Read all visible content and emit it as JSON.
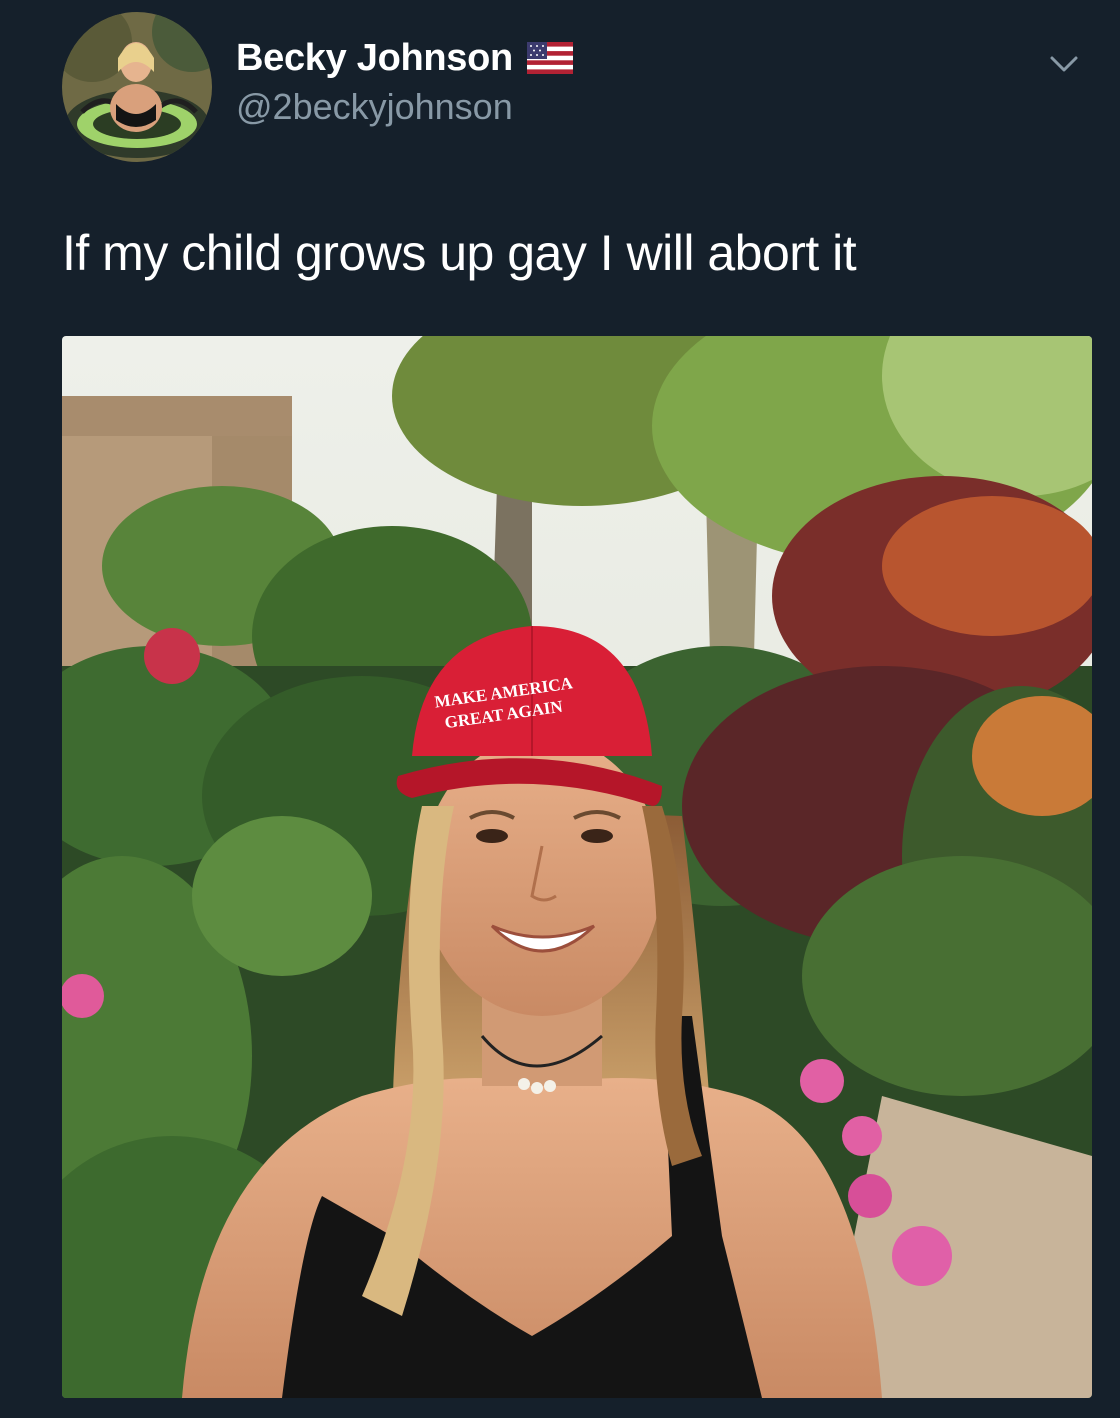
{
  "author": {
    "display_name": "Becky Johnson",
    "handle": "@2beckyjohnson",
    "badge_icon": "us-flag-icon"
  },
  "tweet": {
    "text": "If my child grows up gay I will abort it"
  },
  "media": {
    "hat_line_1": "MAKE AMERICA",
    "hat_line_2": "GREAT AGAIN"
  },
  "icons": {
    "more_menu": "chevron-down-icon"
  },
  "colors": {
    "background": "#15202b",
    "text_primary": "#ffffff",
    "text_secondary": "#8899a6",
    "hat_red": "#d91f36"
  }
}
